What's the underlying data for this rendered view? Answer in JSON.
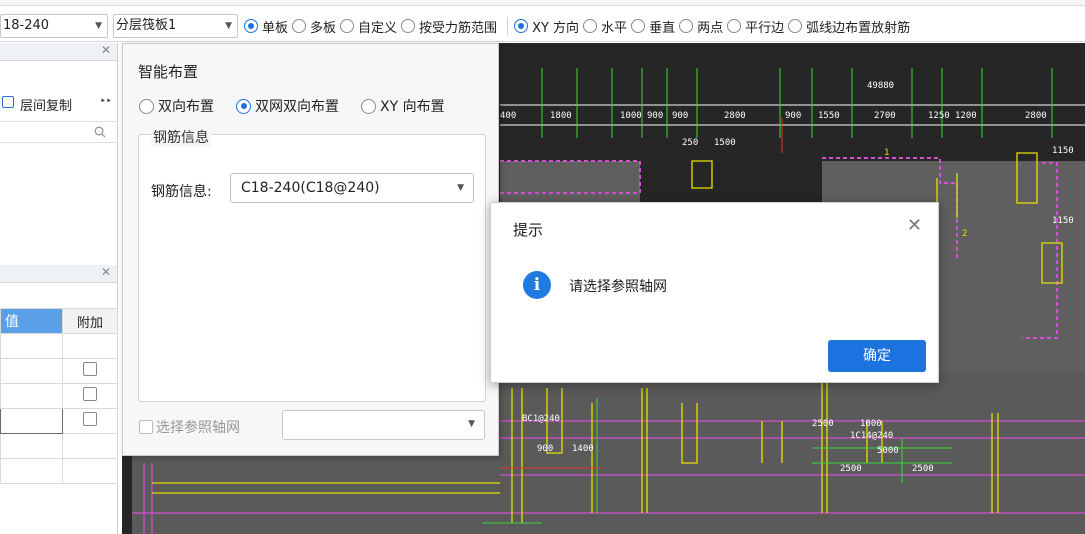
{
  "toolbar": {
    "rebar_combo": "18-240",
    "layer_combo": "分层筏板1",
    "layout_radios": [
      {
        "label": "单板",
        "selected": true
      },
      {
        "label": "多板",
        "selected": false
      },
      {
        "label": "自定义",
        "selected": false
      },
      {
        "label": "按受力筋范围",
        "selected": false
      }
    ],
    "direction_radios": [
      {
        "label": "XY 方向",
        "selected": true
      },
      {
        "label": "水平",
        "selected": false
      },
      {
        "label": "垂直",
        "selected": false
      },
      {
        "label": "两点",
        "selected": false
      },
      {
        "label": "平行边",
        "selected": false
      },
      {
        "label": "弧线边布置放射筋",
        "selected": false
      }
    ]
  },
  "left_panel_1": {
    "copy_label": "层间复制",
    "more_glyph": "‣‣"
  },
  "left_panel_2": {
    "header_value": "值",
    "header_addon": "附加",
    "checkbox_rows": 3
  },
  "smart_panel": {
    "title": "智能布置",
    "modes": [
      {
        "label": "双向布置",
        "selected": false
      },
      {
        "label": "双网双向布置",
        "selected": true
      },
      {
        "label": "XY 向布置",
        "selected": false
      }
    ],
    "rebar_group_legend": "钢筋信息",
    "rebar_info_label": "钢筋信息:",
    "rebar_info_value": "C18-240(C18@240)",
    "axis_check_label": "选择参照轴网",
    "axis_select_value": ""
  },
  "dialog": {
    "title": "提示",
    "message": "请选择参照轴网",
    "ok_label": "确定",
    "close_glyph": "✕",
    "info_glyph": "i"
  },
  "cad": {
    "dims_top": [
      "49880",
      "400",
      "1800",
      "1000",
      "900",
      "900",
      "2800",
      "900",
      "1550",
      "2700",
      "1250",
      "1200",
      "2800"
    ],
    "dims_second": [
      "250",
      "1500",
      "1150",
      "1150"
    ],
    "labels": [
      "BC1@240",
      "1C14@240",
      "2500",
      "1000",
      "5000",
      "2500",
      "2500",
      "1400",
      "900",
      "1",
      "2"
    ],
    "colors": {
      "background": "#262626",
      "yellow": "#e8e000",
      "magenta": "#d34fd3",
      "green": "#38d838",
      "white": "#ffffff",
      "red": "#e0352b",
      "pink_fill": "#6b5a60"
    }
  }
}
